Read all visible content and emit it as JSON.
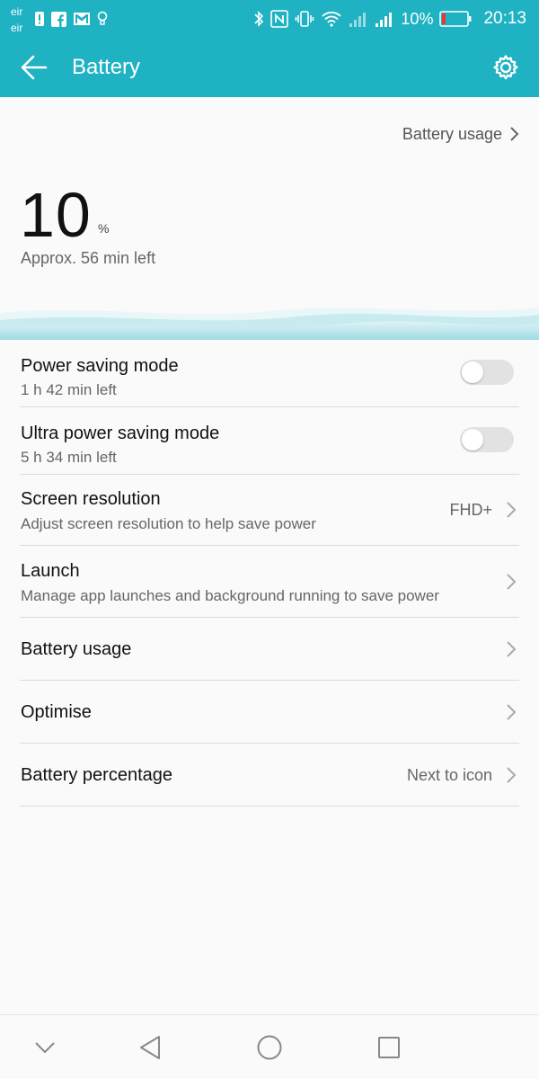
{
  "status_bar": {
    "carrier_1": "eir",
    "carrier_2": "eir",
    "battery_percent": "10%",
    "time": "20:13",
    "left_icons": [
      "alert-icon",
      "facebook-icon",
      "gmail-icon",
      "lightbulb-icon"
    ],
    "right_icons": [
      "bluetooth-icon",
      "nfc-icon",
      "vibrate-icon",
      "wifi-icon",
      "signal-icon",
      "signal-icon",
      "battery-icon"
    ]
  },
  "app_bar": {
    "title": "Battery",
    "color": "#1fb2c2"
  },
  "hero": {
    "usage_link": "Battery usage",
    "percent": "10",
    "percent_unit": "%",
    "remaining": "Approx. 56 min left"
  },
  "list": {
    "power_saving": {
      "title": "Power saving mode",
      "subtitle": "1 h 42 min left",
      "enabled": false
    },
    "ultra_power_saving": {
      "title": "Ultra power saving mode",
      "subtitle": "5 h 34 min left",
      "enabled": false
    },
    "screen_resolution": {
      "title": "Screen resolution",
      "subtitle": "Adjust screen resolution to help save power",
      "value": "FHD+"
    },
    "launch": {
      "title": "Launch",
      "subtitle": "Manage app launches and background running to save power"
    },
    "battery_usage": {
      "title": "Battery usage"
    },
    "optimise": {
      "title": "Optimise"
    },
    "battery_percentage": {
      "title": "Battery percentage",
      "value": "Next to icon"
    }
  },
  "nav_bar": {
    "buttons": [
      "chevron-down-icon",
      "back-triangle-icon",
      "home-circle-icon",
      "recents-square-icon"
    ]
  }
}
